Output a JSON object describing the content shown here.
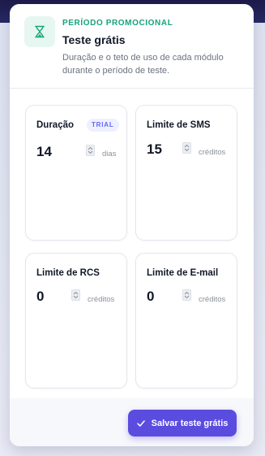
{
  "header": {
    "eyebrow": "PERÍODO PROMOCIONAL",
    "title": "Teste grátis",
    "description": "Duração e o teto de uso de cada módulo durante o período de teste.",
    "icon": "hourglass-icon",
    "accent_color": "#16a37a"
  },
  "modules": {
    "duration": {
      "label": "Duração",
      "badge": "TRIAL",
      "value": "14",
      "unit": "dias"
    },
    "sms": {
      "label": "Limite de SMS",
      "value": "15",
      "unit": "créditos"
    },
    "rcs": {
      "label": "Limite de RCS",
      "value": "0",
      "unit": "créditos"
    },
    "email": {
      "label": "Limite de E-mail",
      "value": "0",
      "unit": "créditos"
    }
  },
  "footer": {
    "save_label": "Salvar teste grátis",
    "save_icon": "check-icon",
    "button_color": "#5b4ce0"
  }
}
